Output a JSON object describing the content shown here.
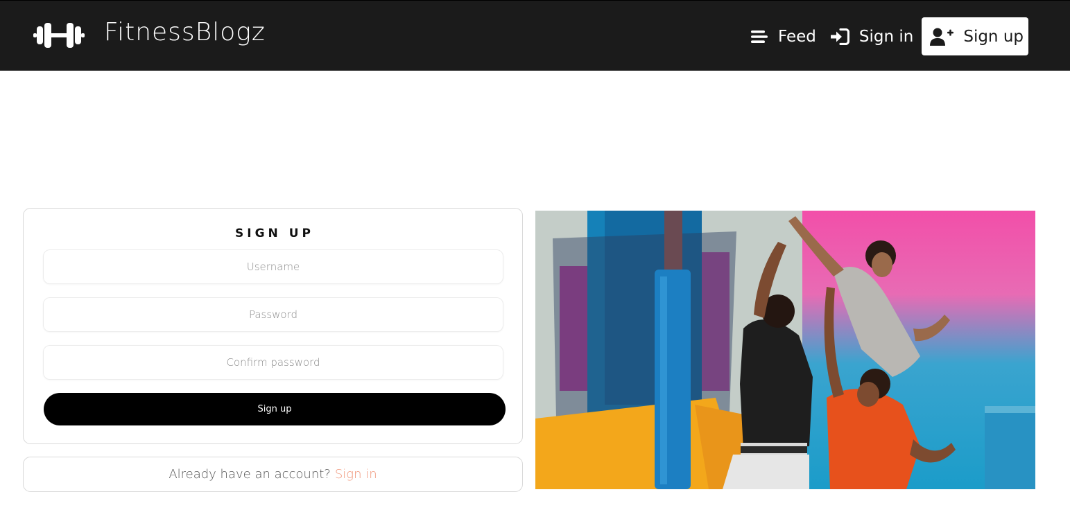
{
  "brand": {
    "name": "FitnessBlogz",
    "icon": "dumbbell-icon"
  },
  "nav": {
    "items": [
      {
        "label": "Feed",
        "icon": "feed-lines-icon"
      },
      {
        "label": "Sign in",
        "icon": "sign-in-icon"
      },
      {
        "label": "Sign up",
        "icon": "user-plus-icon",
        "active": true
      }
    ]
  },
  "form": {
    "title": "SIGN UP",
    "username_placeholder": "Username",
    "password_placeholder": "Password",
    "confirm_placeholder": "Confirm password",
    "submit_label": "Sign up"
  },
  "signin_prompt": {
    "text": "Already have an account?",
    "link_label": "Sign in"
  },
  "hero_image": {
    "subject": "basketball players jumping at a hoop against a colorful wall"
  },
  "colors": {
    "navbar_bg": "#1b1b1b",
    "link_accent": "#f0967a",
    "button_bg": "#000000"
  }
}
